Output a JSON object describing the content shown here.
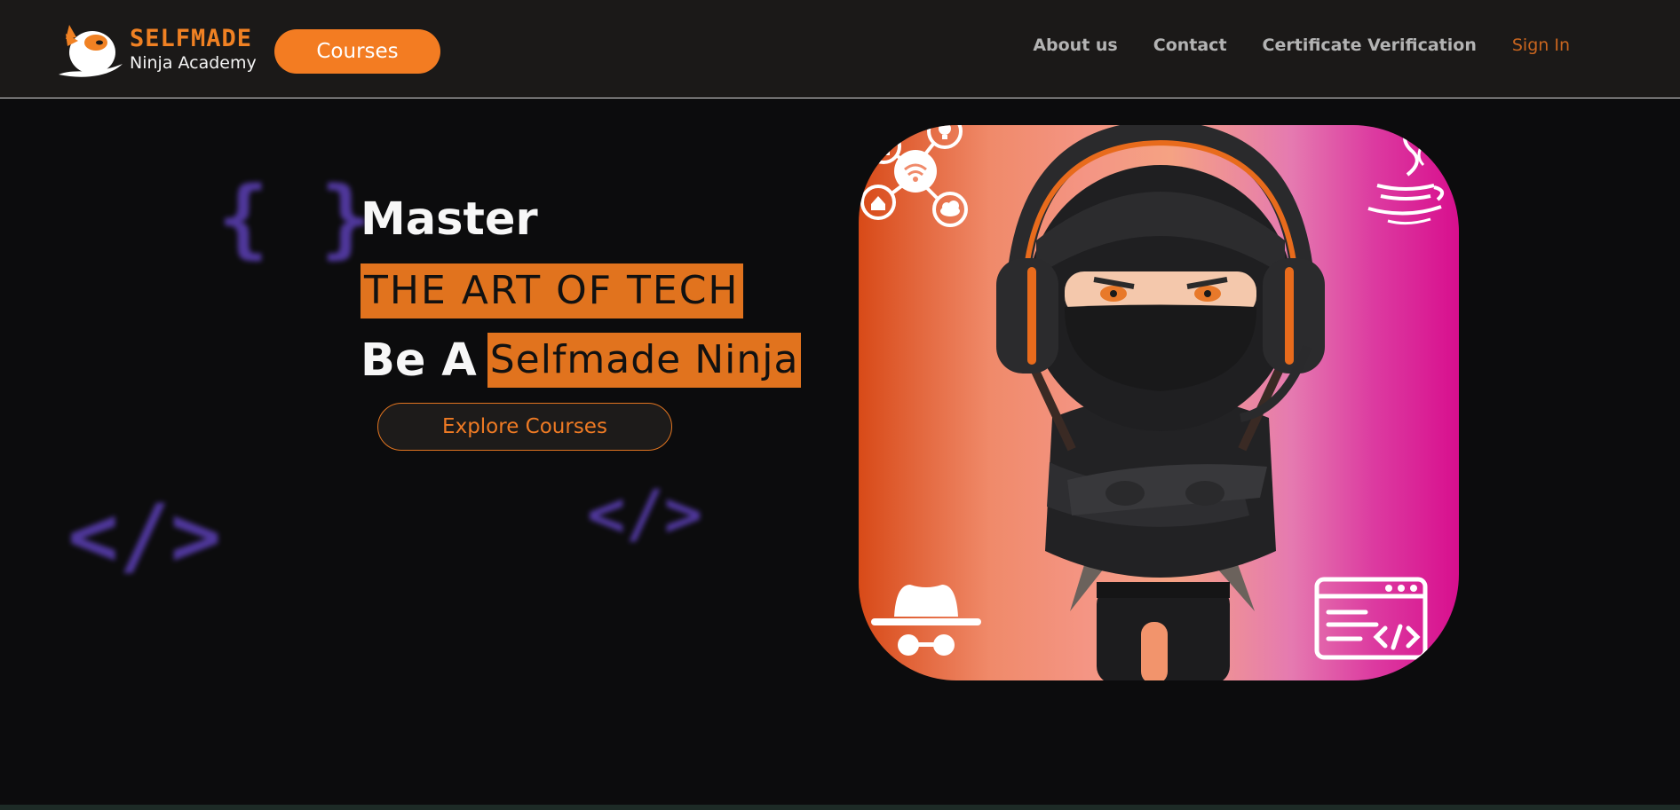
{
  "navbar": {
    "logo_title": "SELFMADE",
    "logo_subtitle": "Ninja Academy",
    "courses_button": "Courses",
    "links": [
      {
        "label": "About us"
      },
      {
        "label": "Contact"
      },
      {
        "label": "Certificate Verification"
      },
      {
        "label": "Sign In"
      }
    ]
  },
  "hero": {
    "line1": "Master",
    "line2": "THE ART OF TECH",
    "line3_prefix": "Be A",
    "line3_highlight": "Selfmade Ninja",
    "cta_button": "Explore Courses",
    "decorations": [
      "{ }",
      "</>",
      "</>"
    ]
  },
  "hero_image": {
    "subject": "ninja-character-with-headset",
    "icons": [
      "iot-network-icon",
      "java-logo-icon",
      "incognito-hacker-icon",
      "code-window-icon"
    ]
  },
  "colors": {
    "accent": "#f37c22",
    "highlight": "#e1731e",
    "background": "#0c0c0d",
    "navbar": "#1b1918",
    "deco_purple": "#5b3fb4"
  }
}
